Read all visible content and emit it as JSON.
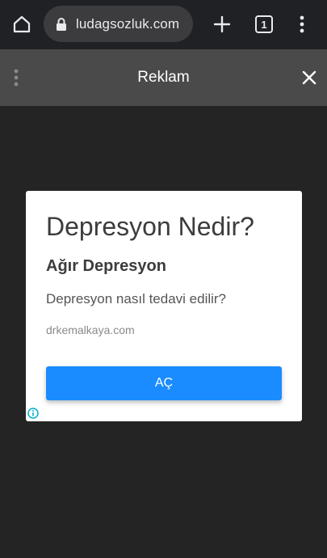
{
  "browser": {
    "url": "ludagsozluk.com",
    "tab_count": "1"
  },
  "ad_header": {
    "title": "Reklam"
  },
  "ad_card": {
    "headline": "Depresyon Nedir?",
    "subheadline": "Ağır Depresyon",
    "description": "Depresyon nasıl tedavi edilir?",
    "domain": "drkemalkaya.com",
    "cta_label": "AÇ"
  },
  "colors": {
    "browser_bar": "#202124",
    "ad_header": "#4a4a4a",
    "page_background": "#242424",
    "cta_button": "#1a8cff",
    "info_icon": "#00aecd"
  },
  "icons": [
    "home-icon",
    "lock-icon",
    "plus-icon",
    "tabs-icon",
    "more-vert-icon",
    "close-icon",
    "info-icon"
  ]
}
